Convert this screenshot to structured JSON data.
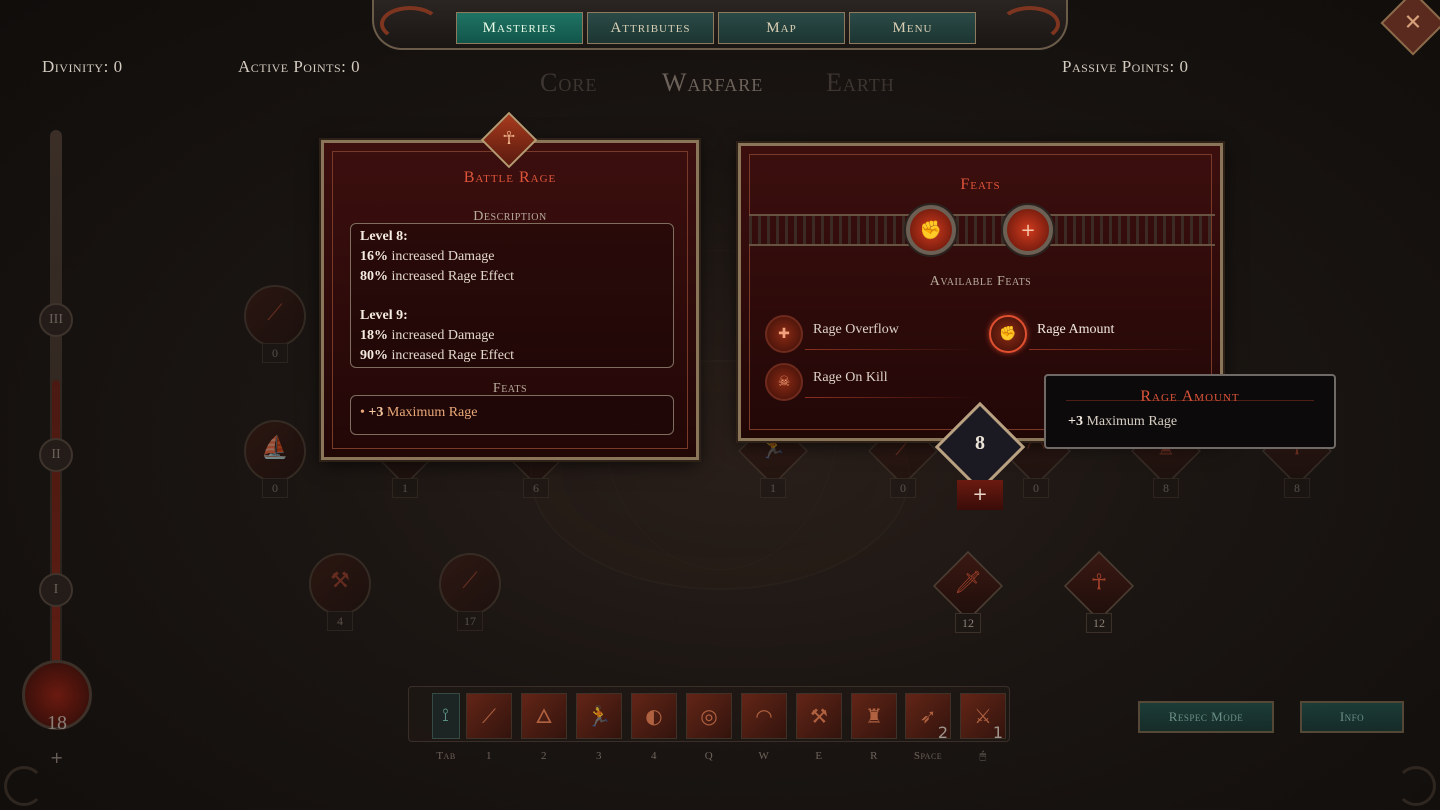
{
  "top_nav": {
    "tabs": [
      {
        "label": "Masteries",
        "active": true
      },
      {
        "label": "Attributes",
        "active": false
      },
      {
        "label": "Map",
        "active": false
      },
      {
        "label": "Menu",
        "active": false
      }
    ],
    "close_icon": "close-icon"
  },
  "stats": {
    "divinity": "Divinity: 0",
    "active_points": "Active Points: 0",
    "passive_points": "Passive Points: 0"
  },
  "subtabs": [
    {
      "label": "Core",
      "active": false
    },
    {
      "label": "Warfare",
      "active": true
    },
    {
      "label": "Earth",
      "active": false
    }
  ],
  "rail": {
    "nodes": [
      "III",
      "II",
      "I"
    ],
    "level": "18",
    "plus": "+"
  },
  "skill_panel": {
    "title": "Battle Rage",
    "description_title": "Description",
    "level8_title": "Level 8:",
    "level8_line1_num": "16%",
    "level8_line1_text": " increased Damage",
    "level8_line2_num": "80%",
    "level8_line2_text": " increased Rage Effect",
    "level9_title": "Level 9:",
    "level9_line1_num": "18%",
    "level9_line1_text": " increased Damage",
    "level9_line2_num": "90%",
    "level9_line2_text": " increased Rage Effect",
    "feats_title": "Feats",
    "feat_bullet": "• ",
    "feat_num": "+3",
    "feat_text": " Maximum Rage",
    "crest_icon": "warrior-icon"
  },
  "feats_panel": {
    "title": "Feats",
    "available_title": "Available Feats",
    "slots": [
      {
        "icon": "rage-fist-icon",
        "glyph": "✊"
      },
      {
        "icon": "plus-icon",
        "glyph": "+"
      }
    ],
    "feats": [
      {
        "label": "Rage Overflow",
        "icon": "plus-cross-icon",
        "glyph": "✚",
        "selected": false
      },
      {
        "label": "Rage Amount",
        "icon": "rage-fist-icon",
        "glyph": "✊",
        "selected": true
      },
      {
        "label": "Rage On Kill",
        "icon": "skull-icon",
        "glyph": "☠",
        "selected": false
      }
    ]
  },
  "level_badge": {
    "value": "8",
    "plus": "+"
  },
  "tooltip": {
    "title": "Rage Amount",
    "body_num": "+3",
    "body_text": " Maximum Rage"
  },
  "skill_nodes": [
    {
      "count": "0"
    },
    {
      "count": "0"
    },
    {
      "count": "1"
    },
    {
      "count": "6"
    },
    {
      "count": "1"
    },
    {
      "count": "0"
    },
    {
      "count": "0"
    },
    {
      "count": "8"
    },
    {
      "count": "8"
    },
    {
      "count": "4"
    },
    {
      "count": "17"
    },
    {
      "count": "12"
    },
    {
      "count": "12"
    }
  ],
  "hotbar": {
    "keys": [
      "Tab",
      "1",
      "2",
      "3",
      "4",
      "Q",
      "W",
      "E",
      "R",
      "Space",
      "🖱"
    ],
    "slots": [
      {
        "icon": "tab-slot-icon",
        "glyph": "⟟"
      },
      {
        "icon": "spear-icon",
        "glyph": "⟋"
      },
      {
        "icon": "eagle-icon",
        "glyph": "🜂"
      },
      {
        "icon": "runner-icon",
        "glyph": "🏃"
      },
      {
        "icon": "shield-bash-icon",
        "glyph": "◐"
      },
      {
        "icon": "whirl-icon",
        "glyph": "◎"
      },
      {
        "icon": "horn-icon",
        "glyph": "◠"
      },
      {
        "icon": "axe-icon",
        "glyph": "⚒"
      },
      {
        "icon": "helmet-icon",
        "glyph": "♜"
      },
      {
        "icon": "dash-icon",
        "glyph": "➶",
        "count": "2"
      },
      {
        "icon": "double-axe-icon",
        "glyph": "⚔",
        "count": "1"
      }
    ]
  },
  "buttons": {
    "respec": "Respec Mode",
    "info": "Info"
  }
}
